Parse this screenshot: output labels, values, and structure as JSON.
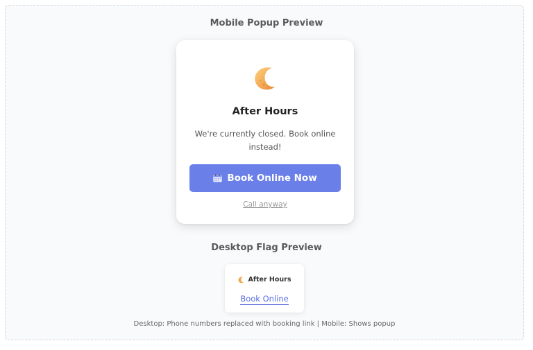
{
  "mobile_section": {
    "title": "Mobile Popup Preview",
    "popup": {
      "icon": "crescent-moon-icon",
      "title": "After Hours",
      "message": "We're currently closed. Book online instead!",
      "book_button_icon": "calendar-icon",
      "book_button_label": "Book Online Now",
      "call_link_label": "Call anyway"
    }
  },
  "desktop_section": {
    "title": "Desktop Flag Preview",
    "flag": {
      "icon": "crescent-moon-icon",
      "status_label": "After Hours",
      "link_label": "Book Online"
    }
  },
  "caption": "Desktop: Phone numbers replaced with booking link | Mobile: Shows popup",
  "colors": {
    "accent": "#6a7fe8",
    "link": "#5b6fe0",
    "moon": "#f3a64a"
  }
}
